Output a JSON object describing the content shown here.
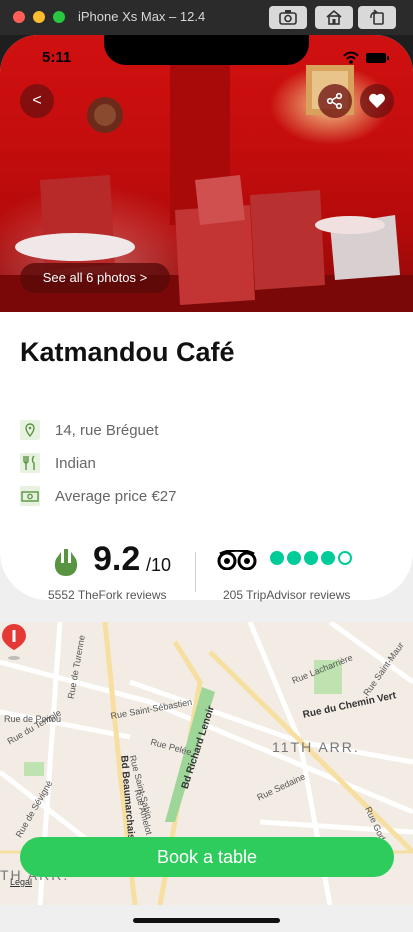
{
  "simulator": {
    "title": "iPhone Xs Max – 12.4"
  },
  "status_bar": {
    "time": "5:11"
  },
  "hero": {
    "back_label": "<",
    "see_photos_label": "See all 6 photos >"
  },
  "restaurant": {
    "name": "Katmandou Café",
    "address": "14, rue Bréguet",
    "cuisine": "Indian",
    "price": "Average price €27"
  },
  "ratings": {
    "thefork_score": "9.2",
    "thefork_max": "/10",
    "thefork_reviews": "5552 TheFork reviews",
    "tripadvisor_bubbles": 4,
    "tripadvisor_bubbles_max": 5,
    "tripadvisor_reviews": "205 TripAdvisor reviews"
  },
  "map": {
    "streets": {
      "rue_de_poitou": "Rue de Poitou",
      "rue_du_temple": "Rue du Temple",
      "rue_de_turenne": "Rue de Turenne",
      "rue_saint_sebastien": "Rue Saint-Sébastien",
      "rue_pelee": "Rue Pelée",
      "rue_saint_sabin": "Rue Saint-Sabin",
      "rue_amelot": "Rue Amelot",
      "bd_beaumarchais": "Bd Beaumarchais",
      "bd_richard_lenoir": "Bd Richard Lenoir",
      "rue_lacharriere": "Rue Lacharrière",
      "rue_saint_maur": "Rue Saint-Maur",
      "rue_du_chemin_vert": "Rue du Chemin Vert",
      "rue_sedaine": "Rue Sedaine",
      "rue_de_sevigne": "Rue de Sévigné",
      "rue_godefroy": "Rue Godef"
    },
    "district": "11TH ARR.",
    "district_partial": "TH ARR.",
    "legal": "Legal"
  },
  "actions": {
    "book_label": "Book a table"
  },
  "colors": {
    "accent_green": "#2ecc5c",
    "tripadvisor_green": "#00cc99",
    "thefork_green": "#589442"
  }
}
